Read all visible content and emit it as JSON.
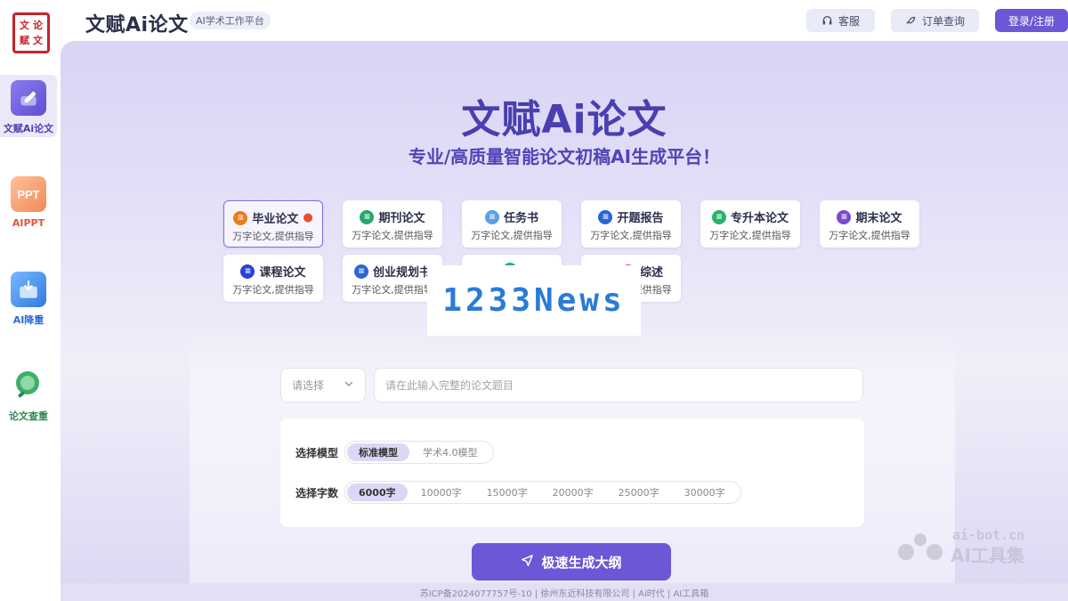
{
  "header": {
    "brand_title": "文赋Ai论文",
    "brand_tag": "AI学术工作平台",
    "logo_chars": [
      "文",
      "论",
      "赋",
      "文"
    ],
    "support_label": "客服",
    "order_label": "订单查询",
    "login_label": "登录/注册"
  },
  "sidebar": {
    "items": [
      {
        "label": "文赋Ai论文",
        "icon": "pen-icon",
        "color": "#6b58d6"
      },
      {
        "label": "AIPPT",
        "icon": "ppt-icon",
        "color": "#e06a3a"
      },
      {
        "label": "AI降重",
        "icon": "download-mail-icon",
        "color": "#2e7be0"
      },
      {
        "label": "论文查重",
        "icon": "magnifier-icon",
        "color": "#2f9a5a"
      }
    ]
  },
  "hero": {
    "title": "文赋Ai论文",
    "subtitle": "专业/高质量智能论文初稿AI生成平台！"
  },
  "paper_types": [
    {
      "title": "毕业论文",
      "sub": "万字论文,提供指导",
      "icon_color": "#f07a1e",
      "selected": true
    },
    {
      "title": "期刊论文",
      "sub": "万字论文,提供指导",
      "icon_color": "#27a86a",
      "selected": false
    },
    {
      "title": "任务书",
      "sub": "万字论文,提供指导",
      "icon_color": "#5aa0e8",
      "selected": false
    },
    {
      "title": "开题报告",
      "sub": "万字论文,提供指导",
      "icon_color": "#2a66d8",
      "selected": false
    },
    {
      "title": "专升本论文",
      "sub": "万字论文,提供指导",
      "icon_color": "#27b36a",
      "selected": false
    },
    {
      "title": "期末论文",
      "sub": "万字论文,提供指导",
      "icon_color": "#7b4ad0",
      "selected": false
    },
    {
      "title": "课程论文",
      "sub": "万字论文,提供指导",
      "icon_color": "#2a3fd8",
      "selected": false
    },
    {
      "title": "创业规划书",
      "sub": "万字论文,提供指导",
      "icon_color": "#2a66d8",
      "selected": false
    },
    {
      "title": "",
      "sub": "",
      "icon_color": "#27b36a",
      "selected": false
    },
    {
      "title": "综述",
      "sub": "万字论文,提供指导",
      "icon_color": "#e04a4a",
      "selected": false
    }
  ],
  "watermark": {
    "text": "1233News"
  },
  "form": {
    "select_placeholder": "请选择",
    "topic_placeholder": "请在此输入完整的论文题目",
    "model_label": "选择模型",
    "models": [
      {
        "label": "标准模型",
        "active": true
      },
      {
        "label": "学术4.0模型",
        "active": false
      }
    ],
    "words_label": "选择字数",
    "word_counts": [
      {
        "label": "6000字",
        "active": true
      },
      {
        "label": "10000字",
        "active": false
      },
      {
        "label": "15000字",
        "active": false
      },
      {
        "label": "20000字",
        "active": false
      },
      {
        "label": "25000字",
        "active": false
      },
      {
        "label": "30000字",
        "active": false
      }
    ],
    "generate_label": "极速生成大纲"
  },
  "footer": {
    "text": "苏ICP备2024077757号-10 | 徐州东近科技有限公司 | Ai时代 | AI工具箱"
  },
  "site_mark": {
    "url": "ai-bot.cn",
    "name": "AI工具集"
  }
}
